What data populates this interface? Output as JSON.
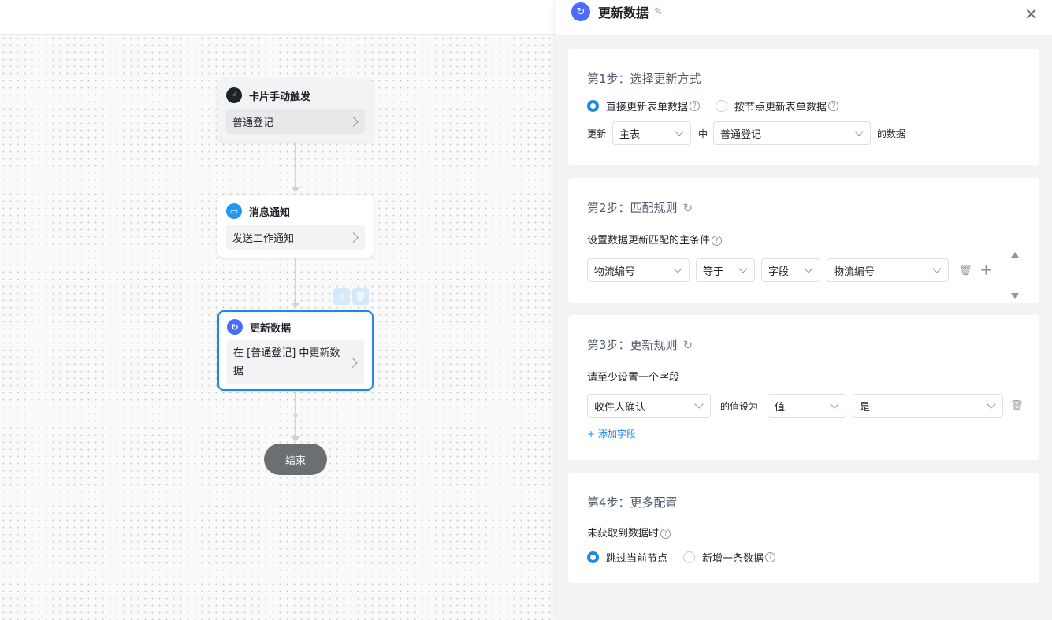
{
  "canvas": {
    "nodes": [
      {
        "title": "卡片手动触发",
        "body": "普通登记",
        "icon": "hand-pointer-icon"
      },
      {
        "title": "消息通知",
        "body": "发送工作通知",
        "icon": "message-icon"
      },
      {
        "title": "更新数据",
        "body": "在 [普通登记] 中更新数据",
        "icon": "refresh-icon"
      }
    ],
    "end_label": "结束"
  },
  "drawer": {
    "title": "更新数据",
    "step1": {
      "title": "第1步：选择更新方式",
      "option_direct": "直接更新表单数据",
      "option_by_node": "按节点更新表单数据",
      "selected": "direct",
      "update_label": "更新",
      "table_select": "主表",
      "in_label": "中",
      "form_select": "普通登记",
      "data_label": "的数据"
    },
    "step2": {
      "title": "第2步：匹配规则",
      "subtitle": "设置数据更新匹配的主条件",
      "field_select": "物流编号",
      "op_select": "等于",
      "type_select": "字段",
      "value_select": "物流编号"
    },
    "step3": {
      "title": "第3步：更新规则",
      "subtitle": "请至少设置一个字段",
      "field_select": "收件人确认",
      "set_label": "的值设为",
      "type_select": "值",
      "value_select": "是",
      "add_field": "+ 添加字段"
    },
    "step4": {
      "title": "第4步：更多配置",
      "subtitle": "未获取到数据时",
      "option_skip": "跳过当前节点",
      "option_add": "新增一条数据",
      "selected": "skip"
    }
  },
  "colors": {
    "accent": "#1e88e5",
    "end_node": "#6b6e72",
    "indigo": "#4a6cf7"
  }
}
